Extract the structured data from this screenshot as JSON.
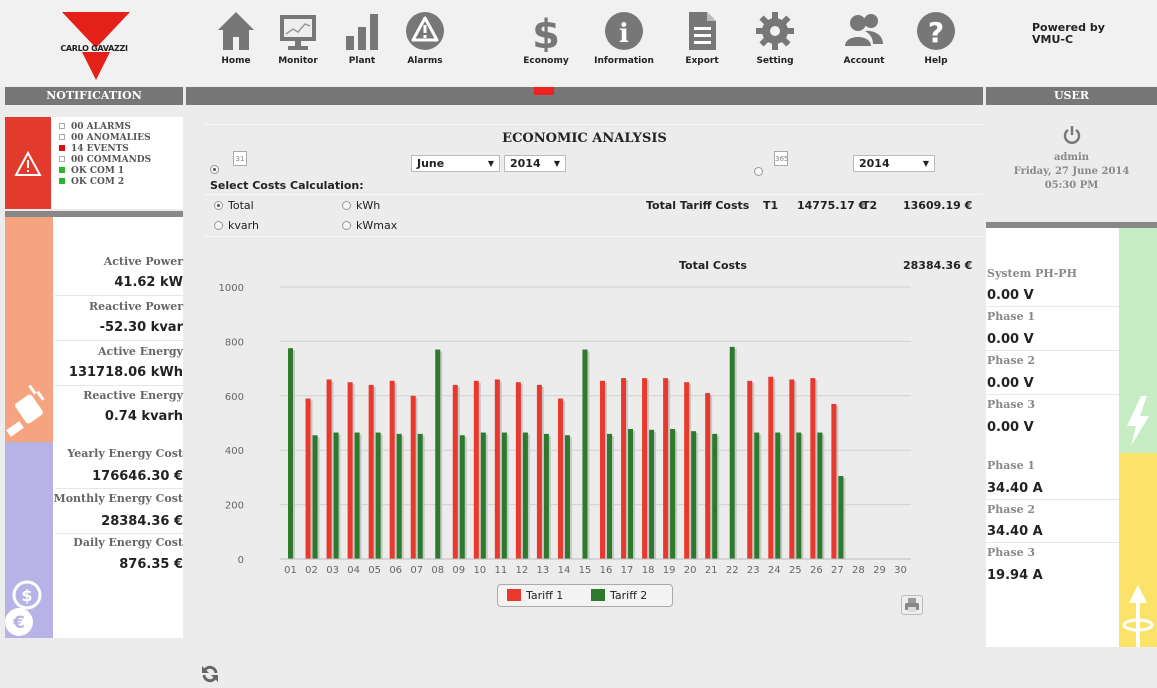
{
  "header": {
    "logo_text": "CARLO GAVAZZI",
    "nav": [
      {
        "label": "Home",
        "icon": "home-icon"
      },
      {
        "label": "Monitor",
        "icon": "monitor-icon"
      },
      {
        "label": "Plant",
        "icon": "plant-bars-icon"
      },
      {
        "label": "Alarms",
        "icon": "alarm-warning-icon"
      },
      {
        "label": "Economy",
        "icon": "dollar-icon"
      },
      {
        "label": "Information",
        "icon": "info-icon"
      },
      {
        "label": "Export",
        "icon": "export-document-icon"
      },
      {
        "label": "Setting",
        "icon": "gear-icon"
      },
      {
        "label": "Account",
        "icon": "account-users-icon"
      },
      {
        "label": "Help",
        "icon": "help-question-icon"
      }
    ],
    "powered_by": "Powered by",
    "product": "VMU-C"
  },
  "notification": {
    "title": "NOTIFICATION",
    "items": [
      {
        "status": "00",
        "label": "ALARMS",
        "indicator": "empty"
      },
      {
        "status": "00",
        "label": "ANOMALIES",
        "indicator": "empty"
      },
      {
        "status": "14",
        "label": "EVENTS",
        "indicator": "red"
      },
      {
        "status": "00",
        "label": "COMMANDS",
        "indicator": "empty"
      },
      {
        "status": "OK",
        "label": "COM 1",
        "indicator": "green"
      },
      {
        "status": "OK",
        "label": "COM 2",
        "indicator": "green"
      }
    ]
  },
  "power_panel": {
    "active_power_label": "Active Power",
    "active_power_value": "41.62 kW",
    "reactive_power_label": "Reactive Power",
    "reactive_power_value": "-52.30 kvar",
    "active_energy_label": "Active Energy",
    "active_energy_value": "131718.06 kWh",
    "reactive_energy_label": "Reactive Energy",
    "reactive_energy_value": "0.74 kvarh"
  },
  "cost_panel": {
    "yearly_label": "Yearly Energy Cost",
    "yearly_value": "176646.30 €",
    "monthly_label": "Monthly Energy Cost",
    "monthly_value": "28384.36 €",
    "daily_label": "Daily Energy Cost",
    "daily_value": "876.35 €"
  },
  "economic": {
    "title": "ECONOMIC ANALYSIS",
    "month_icon_text": "31",
    "year_icon_text": "365",
    "month_select": "June",
    "year_select": "2014",
    "year_only_select": "2014",
    "select_costs_label": "Select Costs Calculation:",
    "options": [
      "Total",
      "kWh",
      "kvarh",
      "kWmax"
    ],
    "selected_option": "Total",
    "total_tariff_label": "Total Tariff Costs",
    "t1_label": "T1",
    "t1_value": "14775.17 €",
    "t2_label": "T2",
    "t2_value": "13609.19 €",
    "total_costs_label": "Total Costs",
    "total_costs_value": "28384.36 €"
  },
  "chart_data": {
    "type": "bar",
    "categories": [
      "01",
      "02",
      "03",
      "04",
      "05",
      "06",
      "07",
      "08",
      "09",
      "10",
      "11",
      "12",
      "13",
      "14",
      "15",
      "16",
      "17",
      "18",
      "19",
      "20",
      "21",
      "22",
      "23",
      "24",
      "25",
      "26",
      "27",
      "28",
      "29",
      "30"
    ],
    "series": [
      {
        "name": "Tariff 1",
        "color": "#e8392c",
        "values": [
          0,
          590,
          660,
          650,
          640,
          655,
          600,
          0,
          640,
          655,
          660,
          650,
          640,
          590,
          0,
          655,
          665,
          665,
          665,
          650,
          610,
          0,
          655,
          670,
          660,
          665,
          570,
          0,
          0,
          0
        ]
      },
      {
        "name": "Tariff 2",
        "color": "#2d7a2d",
        "values": [
          775,
          455,
          465,
          465,
          465,
          460,
          460,
          770,
          455,
          465,
          465,
          465,
          460,
          455,
          770,
          460,
          478,
          475,
          478,
          470,
          460,
          780,
          465,
          465,
          465,
          465,
          305,
          0,
          0,
          0
        ]
      }
    ],
    "ylim": [
      0,
      1000
    ],
    "yticks": [
      0,
      200,
      400,
      600,
      800,
      1000
    ],
    "grid": true,
    "legend": "bottom-center"
  },
  "user": {
    "title": "USER",
    "name": "admin",
    "date": "Friday, 27 June 2014",
    "time": "05:30 PM"
  },
  "voltage_panel": {
    "sys_label": "System PH-PH",
    "sys_value": "0.00 V",
    "p1_label": "Phase 1",
    "p1_value": "0.00 V",
    "p2_label": "Phase 2",
    "p2_value": "0.00 V",
    "p3_label": "Phase 3",
    "p3_value": "0.00 V"
  },
  "current_panel": {
    "p1_label": "Phase 1",
    "p1_value": "34.40 A",
    "p2_label": "Phase 2",
    "p2_value": "34.40 A",
    "p3_label": "Phase 3",
    "p3_value": "19.94 A"
  }
}
